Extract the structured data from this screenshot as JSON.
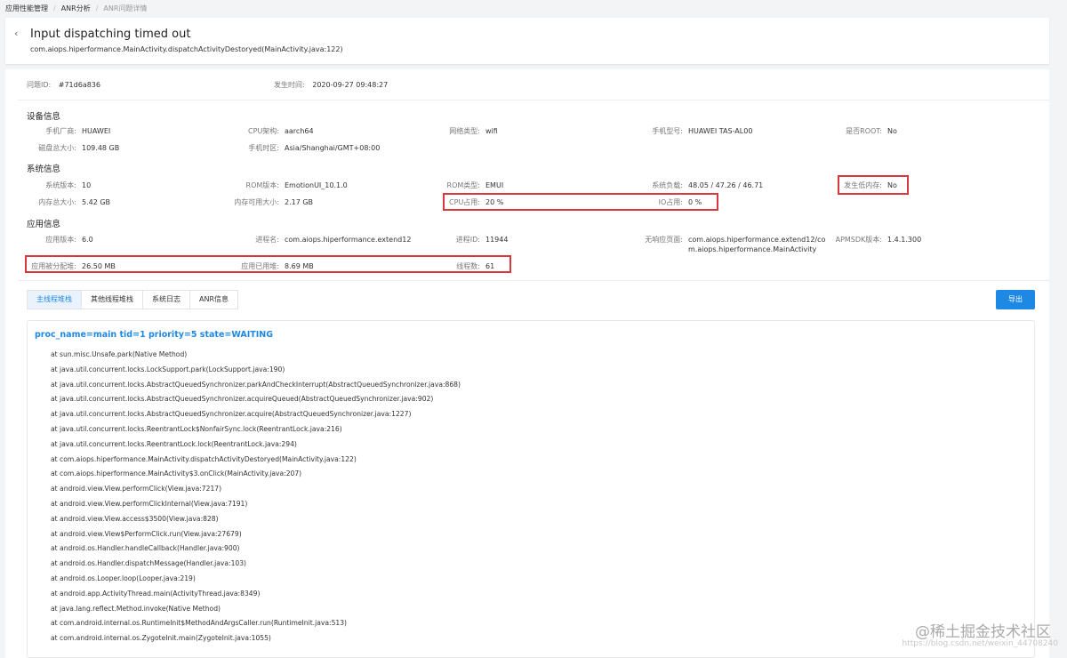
{
  "breadcrumb": {
    "items": [
      "应用性能管理",
      "ANR分析",
      "ANR问题详情"
    ],
    "separator": "/"
  },
  "header": {
    "title": "Input dispatching timed out",
    "subtitle": "com.aiops.hiperformance.MainActivity.dispatchActivityDestoryed(MainActivity.java:122)"
  },
  "issue": {
    "id_label": "问题ID:",
    "id_value": "#71d6a836",
    "time_label": "发生时间:",
    "time_value": "2020-09-27 09:48:27"
  },
  "device": {
    "title": "设备信息",
    "fields": [
      {
        "label": "手机厂商:",
        "value": "HUAWEI"
      },
      {
        "label": "CPU架构:",
        "value": "aarch64"
      },
      {
        "label": "网络类型:",
        "value": "wifi"
      },
      {
        "label": "手机型号:",
        "value": "HUAWEI TAS-AL00"
      },
      {
        "label": "是否ROOT:",
        "value": "No"
      },
      {
        "label": "磁盘总大小:",
        "value": "109.48 GB"
      },
      {
        "label": "手机时区:",
        "value": "Asia/Shanghai/GMT+08:00"
      }
    ]
  },
  "system": {
    "title": "系统信息",
    "fields": [
      {
        "label": "系统版本:",
        "value": "10"
      },
      {
        "label": "ROM版本:",
        "value": "EmotionUI_10.1.0"
      },
      {
        "label": "ROM类型:",
        "value": "EMUI"
      },
      {
        "label": "系统负载:",
        "value": "48.05 / 47.26 / 46.71"
      },
      {
        "label": "发生低内存:",
        "value": "No"
      },
      {
        "label": "内存总大小:",
        "value": "5.42 GB"
      },
      {
        "label": "内存可用大小:",
        "value": "2.17 GB"
      },
      {
        "label": "CPU占用:",
        "value": "20 %"
      },
      {
        "label": "IO占用:",
        "value": "0 %"
      }
    ]
  },
  "app": {
    "title": "应用信息",
    "fields": [
      {
        "label": "应用版本:",
        "value": "6.0"
      },
      {
        "label": "进程名:",
        "value": "com.aiops.hiperformance.extend12"
      },
      {
        "label": "进程ID:",
        "value": "11944"
      },
      {
        "label": "无响应页面:",
        "value": "com.aiops.hiperformance.extend12/com.aiops.hiperformance.MainActivity"
      },
      {
        "label": "APMSDK版本:",
        "value": "1.4.1.300"
      },
      {
        "label": "应用被分配堆:",
        "value": "26.50 MB"
      },
      {
        "label": "应用已用堆:",
        "value": "8.69 MB"
      },
      {
        "label": "线程数:",
        "value": "61"
      }
    ]
  },
  "tabs": [
    "主线程堆栈",
    "其他线程堆栈",
    "系统日志",
    "ANR信息"
  ],
  "export_label": "导出",
  "stack": {
    "header": "proc_name=main tid=1 priority=5 state=WAITING",
    "lines": [
      "at sun.misc.Unsafe.park(Native Method)",
      "at java.util.concurrent.locks.LockSupport.park(LockSupport.java:190)",
      "at java.util.concurrent.locks.AbstractQueuedSynchronizer.parkAndCheckInterrupt(AbstractQueuedSynchronizer.java:868)",
      "at java.util.concurrent.locks.AbstractQueuedSynchronizer.acquireQueued(AbstractQueuedSynchronizer.java:902)",
      "at java.util.concurrent.locks.AbstractQueuedSynchronizer.acquire(AbstractQueuedSynchronizer.java:1227)",
      "at java.util.concurrent.locks.ReentrantLock$NonfairSync.lock(ReentrantLock.java:216)",
      "at java.util.concurrent.locks.ReentrantLock.lock(ReentrantLock.java:294)",
      "at com.aiops.hiperformance.MainActivity.dispatchActivityDestoryed(MainActivity.java:122)",
      "at com.aiops.hiperformance.MainActivity$3.onClick(MainActivity.java:207)",
      "at android.view.View.performClick(View.java:7217)",
      "at android.view.View.performClickInternal(View.java:7191)",
      "at android.view.View.access$3500(View.java:828)",
      "at android.view.View$PerformClick.run(View.java:27679)",
      "at android.os.Handler.handleCallback(Handler.java:900)",
      "at android.os.Handler.dispatchMessage(Handler.java:103)",
      "at android.os.Looper.loop(Looper.java:219)",
      "at android.app.ActivityThread.main(ActivityThread.java:8349)",
      "at java.lang.reflect.Method.invoke(Native Method)",
      "at com.android.internal.os.RuntimeInit$MethodAndArgsCaller.run(RuntimeInit.java:513)",
      "at com.android.internal.os.ZygoteInit.main(ZygoteInit.java:1055)"
    ]
  },
  "watermark": {
    "text": "@稀土掘金技术社区",
    "url": "https://blog.csdn.net/weixin_44708240"
  },
  "colors": {
    "accent": "#1e88e5",
    "highlight_box": "#d9363e"
  }
}
